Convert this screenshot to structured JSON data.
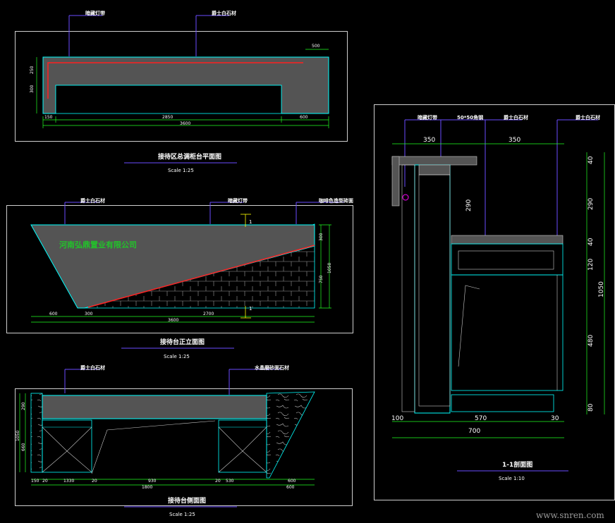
{
  "plan": {
    "label_left": "暗藏灯带",
    "label_right": "爵士白石材",
    "dim_top": "500",
    "dim_v1": "300",
    "dim_v2": "250",
    "dim_b1": "150",
    "dim_b2": "2850",
    "dim_b3": "600",
    "dim_total": "3600",
    "title": "接待区总调柜台平面图",
    "scale": "Scale  1:25"
  },
  "front": {
    "label_a": "爵士白石材",
    "label_b": "暗藏灯带",
    "label_c": "咖啡色造型砖面",
    "company": "河南弘鼎置业有限公司",
    "marker": "1",
    "dim_b1": "600",
    "dim_b2": "300",
    "dim_b3": "2700",
    "dim_total": "3600",
    "dim_r1": "300",
    "dim_r2": "750",
    "dim_r3": "1050",
    "title": "接待台正立面图",
    "scale": "Scale  1:25"
  },
  "side": {
    "label_a": "爵士白石材",
    "label_b": "水晶磨砂面石材",
    "dim_v1": "290",
    "dim_v2": "1050",
    "dim_v3": "660",
    "dim_b": [
      "150",
      "20",
      "1330",
      "20",
      "930",
      "20",
      "530",
      "600"
    ],
    "dim_total": "1800",
    "dim_total2": "600",
    "title": "接待台侧面图",
    "scale": "Scale  1:25"
  },
  "section": {
    "label_a": "暗藏灯带",
    "label_b": "50*50角钢",
    "label_c": "爵士白石材",
    "label_d": "爵士白石材",
    "dim_top_l": "350",
    "dim_top_r": "350",
    "dim_290": "290",
    "dim_r": [
      "40",
      "290",
      "40",
      "120",
      "480",
      "80"
    ],
    "dim_1050": "1050",
    "dim_b": [
      "100",
      "570",
      "30"
    ],
    "dim_total": "700",
    "title": "1-1剖面图",
    "scale": "Scale  1:10"
  },
  "watermark": "www.snren.com",
  "colors": {
    "line": "#00ffff",
    "fill": "#545454",
    "red": "#ff2020",
    "green": "#22ff22",
    "yellow": "#ffff00",
    "magenta": "#ff00ff",
    "leader": "#6a4cff"
  }
}
